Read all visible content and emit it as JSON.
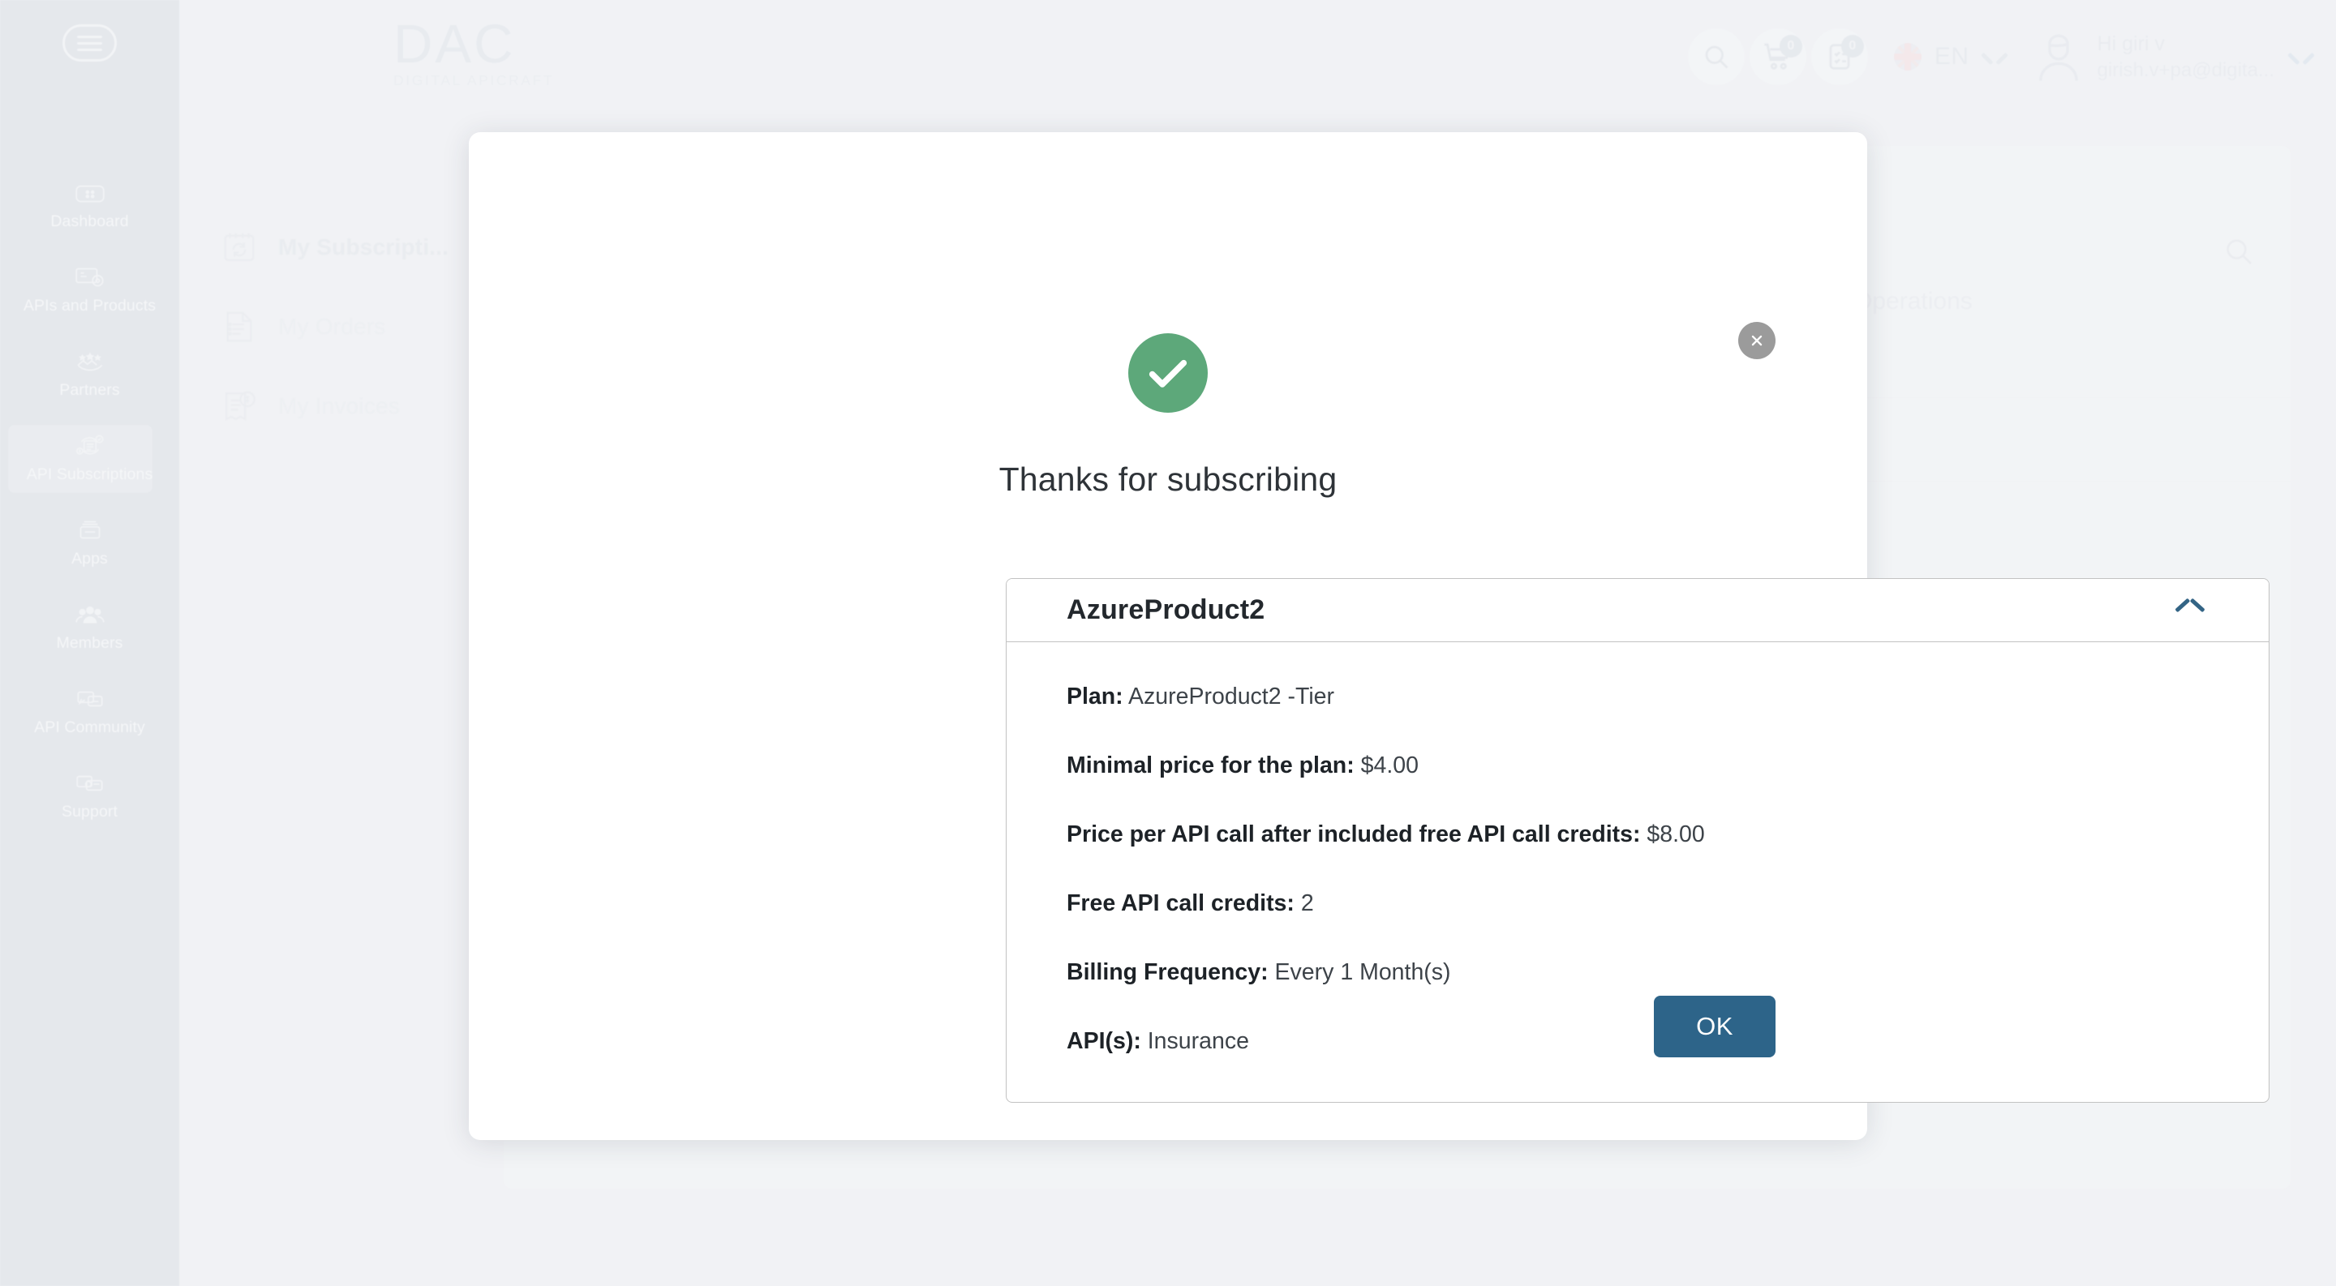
{
  "colors": {
    "page_background": "#ecedf1",
    "rail_background": "#dbdfe5",
    "accent_blue": "#2d6489",
    "chevron_blue": "#336485",
    "success_green": "#5da87a",
    "close_gray": "#9b9b9b",
    "modal_white": "#ffffff"
  },
  "brand": {
    "logo_main": "DAC",
    "logo_sub": "DIGITAL APICRAFT"
  },
  "rail": {
    "menu_icon": "hamburger-menu-icon",
    "items": [
      {
        "label": "Dashboard",
        "icon": "dashboard-icon",
        "active": false
      },
      {
        "label": "APIs and Products",
        "icon": "apis-products-icon",
        "active": false
      },
      {
        "label": "Partners",
        "icon": "partners-handshake-icon",
        "active": false
      },
      {
        "label": "API Subscriptions",
        "icon": "api-subscriptions-icon",
        "active": true
      },
      {
        "label": "Apps",
        "icon": "apps-box-icon",
        "active": false
      },
      {
        "label": "Members",
        "icon": "members-group-icon",
        "active": false
      },
      {
        "label": "API Community",
        "icon": "community-chat-icon",
        "active": false
      },
      {
        "label": "Support",
        "icon": "support-chat-icon",
        "active": false
      }
    ]
  },
  "header": {
    "search_icon": "search-icon",
    "cart": {
      "icon": "shopping-cart-icon",
      "badge": "0"
    },
    "orders": {
      "icon": "clipboard-list-icon",
      "badge": "0"
    },
    "language": {
      "flag": "uk-flag-icon",
      "code": "EN",
      "chevron": "chevron-down-icon"
    },
    "user": {
      "avatar_icon": "user-avatar-icon",
      "greeting": "Hi giri v",
      "email": "girish.v+pa@digita...",
      "chevron": "chevron-down-icon"
    }
  },
  "background_page": {
    "subnav": [
      {
        "label": "My Subscripti...",
        "icon": "subscriptions-calendar-icon",
        "active": true
      },
      {
        "label": "My Orders",
        "icon": "orders-document-icon",
        "active": false
      },
      {
        "label": "My Invoices",
        "icon": "invoices-dollar-icon",
        "active": false
      }
    ],
    "panel_search_icon": "search-icon",
    "tab_label": "Operations",
    "loading_dots": "ellipsis-loading-icon"
  },
  "modal": {
    "close_icon": "close-icon",
    "success_icon": "check-circle-icon",
    "title": "Thanks for subscribing",
    "accordion": {
      "product_name": "AzureProduct2",
      "expanded": true,
      "toggle_icon": "chevron-up-icon",
      "details": [
        {
          "key": "Plan:",
          "value": "AzureProduct2 -Tier"
        },
        {
          "key": "Minimal price for the plan:",
          "value": "$4.00"
        },
        {
          "key": "Price per API call after included free API call credits:",
          "value": "$8.00"
        },
        {
          "key": "Free API call credits:",
          "value": "2"
        },
        {
          "key": "Billing Frequency:",
          "value": "Every 1 Month(s)"
        },
        {
          "key": "API(s):",
          "value": "Insurance"
        }
      ]
    },
    "ok_label": "OK"
  }
}
